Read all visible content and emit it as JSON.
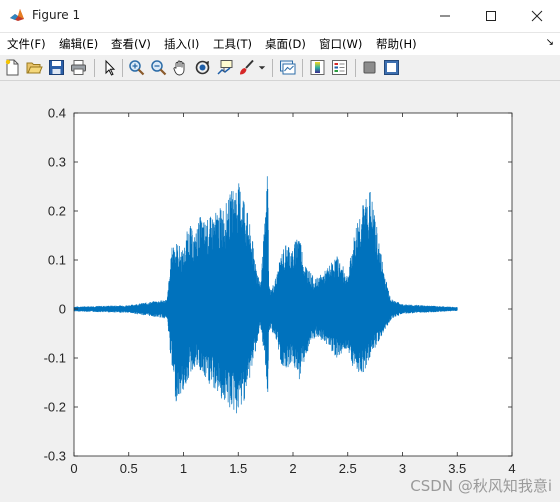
{
  "window": {
    "title": "Figure 1",
    "minimize_icon": "minimize-icon",
    "maximize_icon": "maximize-icon",
    "close_icon": "close-icon"
  },
  "menu": {
    "items": [
      {
        "label": "文件(F)"
      },
      {
        "label": "编辑(E)"
      },
      {
        "label": "查看(V)"
      },
      {
        "label": "插入(I)"
      },
      {
        "label": "工具(T)"
      },
      {
        "label": "桌面(D)"
      },
      {
        "label": "窗口(W)"
      },
      {
        "label": "帮助(H)"
      }
    ],
    "overflow_icon": "corner-arrow-icon"
  },
  "toolbar": {
    "buttons": [
      {
        "name": "new-figure-icon"
      },
      {
        "name": "open-file-icon"
      },
      {
        "name": "save-icon"
      },
      {
        "name": "print-icon"
      },
      {
        "name": "edit-pointer-icon"
      },
      {
        "name": "zoom-in-icon"
      },
      {
        "name": "zoom-out-icon"
      },
      {
        "name": "pan-hand-icon"
      },
      {
        "name": "rotate-3d-icon"
      },
      {
        "name": "data-cursor-icon"
      },
      {
        "name": "brush-icon"
      },
      {
        "name": "link-plot-icon"
      },
      {
        "name": "colorbar-icon"
      },
      {
        "name": "legend-icon"
      },
      {
        "name": "hide-plot-tools-icon"
      },
      {
        "name": "show-plot-tools-icon"
      }
    ]
  },
  "watermark": "CSDN @秋风知我意i",
  "colors": {
    "line": "#0072bd",
    "axes_bg": "#ffffff",
    "figure_bg": "#f0f0f0"
  },
  "chart_data": {
    "type": "line",
    "title": "",
    "xlabel": "",
    "ylabel": "",
    "xlim": [
      0,
      4
    ],
    "ylim": [
      -0.3,
      0.4
    ],
    "xticks": [
      "0",
      "0.5",
      "1",
      "1.5",
      "2",
      "2.5",
      "3",
      "3.5",
      "4"
    ],
    "yticks": [
      "-0.3",
      "-0.2",
      "-0.1",
      "0",
      "0.1",
      "0.2",
      "0.3",
      "0.4"
    ],
    "grid": false,
    "series": [
      {
        "name": "",
        "envelope_x": [
          0,
          0.5,
          0.85,
          0.9,
          0.93,
          1.0,
          1.05,
          1.1,
          1.15,
          1.2,
          1.3,
          1.4,
          1.45,
          1.5,
          1.55,
          1.6,
          1.7,
          1.75,
          1.77,
          1.78,
          1.8,
          1.85,
          1.9,
          1.95,
          2.0,
          2.05,
          2.1,
          2.15,
          2.2,
          2.3,
          2.4,
          2.5,
          2.55,
          2.6,
          2.65,
          2.7,
          2.75,
          2.8,
          2.85,
          2.9,
          3.0,
          3.5
        ],
        "envelope_max": [
          0.005,
          0.008,
          0.02,
          0.14,
          0.14,
          0.12,
          0.18,
          0.15,
          0.19,
          0.18,
          0.2,
          0.22,
          0.25,
          0.26,
          0.24,
          0.18,
          0.05,
          0.2,
          0.31,
          0.05,
          0.04,
          0.07,
          0.12,
          0.14,
          0.12,
          0.17,
          0.1,
          0.08,
          0.06,
          0.08,
          0.11,
          0.07,
          0.14,
          0.2,
          0.22,
          0.25,
          0.19,
          0.12,
          0.06,
          0.02,
          0.01,
          0.004
        ],
        "envelope_min": [
          -0.005,
          -0.008,
          -0.02,
          -0.14,
          -0.19,
          -0.17,
          -0.14,
          -0.12,
          -0.13,
          -0.15,
          -0.17,
          -0.2,
          -0.21,
          -0.22,
          -0.19,
          -0.15,
          -0.04,
          -0.12,
          -0.19,
          -0.05,
          -0.04,
          -0.07,
          -0.12,
          -0.12,
          -0.11,
          -0.15,
          -0.11,
          -0.08,
          -0.06,
          -0.07,
          -0.1,
          -0.08,
          -0.12,
          -0.13,
          -0.13,
          -0.1,
          -0.08,
          -0.06,
          -0.04,
          -0.02,
          -0.01,
          -0.004
        ]
      }
    ]
  }
}
